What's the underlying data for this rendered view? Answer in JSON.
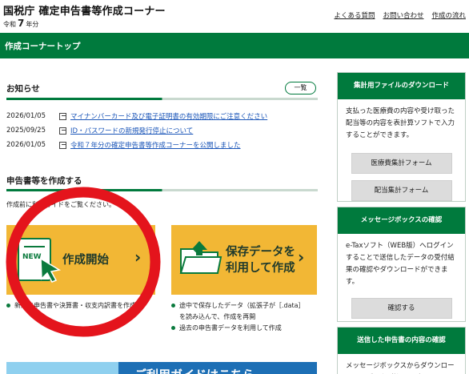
{
  "header": {
    "title": "国税庁 確定申告書等作成コーナー",
    "year_prefix": "令和",
    "year_num": "7",
    "year_suffix": "年分",
    "links": [
      "よくある質問",
      "お問い合わせ",
      "作成の流れ"
    ]
  },
  "greenbar": {
    "label": "作成コーナートップ"
  },
  "news": {
    "heading": "お知らせ",
    "list_button": "一覧",
    "items": [
      {
        "date": "2026/01/05",
        "text": "マイナンバーカード及び電子証明書の有効期限にご注意ください"
      },
      {
        "date": "2025/09/25",
        "text": "ID・パスワードの新規発行停止について"
      },
      {
        "date": "2026/01/05",
        "text": "令和７年分の確定申告書等作成コーナーを公開しました"
      }
    ]
  },
  "create": {
    "heading": "申告書等を作成する",
    "note": "作成前に利用ガイドをご覧ください。",
    "tile1_new": "NEW",
    "tile1_label": "作成開始",
    "tile2_label_1": "保存データを",
    "tile2_label_2": "利用して作成",
    "chevron": "›",
    "notes1": [
      "新規に申告書や決算書・収支内訳書を作成"
    ],
    "notes2": [
      "途中で保存したデータ（拡張子が［.data］",
      "を読み込んで、作成を再開",
      "過去の申告書データを利用して作成"
    ],
    "banner_text": "ご利用ガイドはこちら"
  },
  "sidebar": {
    "box1": {
      "title": "集計用ファイルのダウンロード",
      "text": "支払った医療費の内容や受け取った配当等の内容を表計算ソフトで入力することができます。",
      "buttons": [
        "医療費集計フォーム",
        "配当集計フォーム"
      ]
    },
    "box2": {
      "title": "メッセージボックスの確認",
      "text": "e-Taxソフト（WEB版）へログインすることで送信したデータの受付結果の確認やダウンロードができます。",
      "button": "確認する"
    },
    "box3": {
      "title": "送信した申告書の内容の確認",
      "text": "メッセージボックスからダウンロードしたデータ（拡張子が"
    }
  },
  "colors": {
    "green": "#007a3d",
    "tile": "#f2b735",
    "link": "#1a55b8",
    "annotation_red": "#e4141c"
  }
}
